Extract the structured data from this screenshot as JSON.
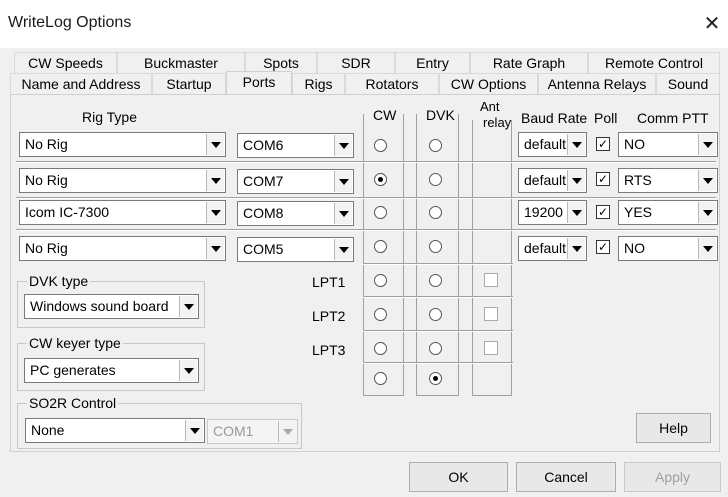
{
  "window": {
    "title": "WriteLog Options",
    "close_glyph": "✕"
  },
  "tabs": {
    "row1": [
      "CW Speeds",
      "Buckmaster",
      "Spots",
      "SDR",
      "Entry",
      "Rate Graph",
      "Remote Control"
    ],
    "row2": [
      "Name and Address",
      "Startup",
      "Ports",
      "Rigs",
      "Rotators",
      "CW Options",
      "Antenna Relays",
      "Sound"
    ],
    "active": "Ports"
  },
  "headers": {
    "rig_type": "Rig Type",
    "cw": "CW",
    "dvk": "DVK",
    "ant_relay_1": "Ant",
    "ant_relay_2": "relay",
    "baud_rate": "Baud Rate",
    "poll": "Poll",
    "comm_ptt": "Comm PTT"
  },
  "rigs": [
    {
      "rig": "No Rig",
      "port": "COM6",
      "cw": false,
      "dvk": false,
      "baud": "default",
      "poll": true,
      "ptt": "NO"
    },
    {
      "rig": "No Rig",
      "port": "COM7",
      "cw": true,
      "dvk": false,
      "baud": "default",
      "poll": true,
      "ptt": "RTS"
    },
    {
      "rig": "Icom IC-7300",
      "port": "COM8",
      "cw": false,
      "dvk": false,
      "baud": "19200",
      "poll": true,
      "ptt": "YES"
    },
    {
      "rig": "No Rig",
      "port": "COM5",
      "cw": false,
      "dvk": false,
      "baud": "default",
      "poll": true,
      "ptt": "NO"
    }
  ],
  "lpt": [
    {
      "label": "LPT1",
      "cw": false,
      "dvk": false,
      "relay": false
    },
    {
      "label": "LPT2",
      "cw": false,
      "dvk": false,
      "relay": false
    },
    {
      "label": "LPT3",
      "cw": false,
      "dvk": false,
      "relay": false
    }
  ],
  "extra_row": {
    "cw": false,
    "dvk": true
  },
  "dvk_type": {
    "label": "DVK type",
    "value": "Windows sound board"
  },
  "cw_keyer": {
    "label": "CW keyer type",
    "value": "PC generates"
  },
  "so2r": {
    "label": "SO2R Control",
    "value": "None",
    "port": "COM1"
  },
  "buttons": {
    "help": "Help",
    "ok": "OK",
    "cancel": "Cancel",
    "apply": "Apply"
  },
  "check_glyph": "✓"
}
